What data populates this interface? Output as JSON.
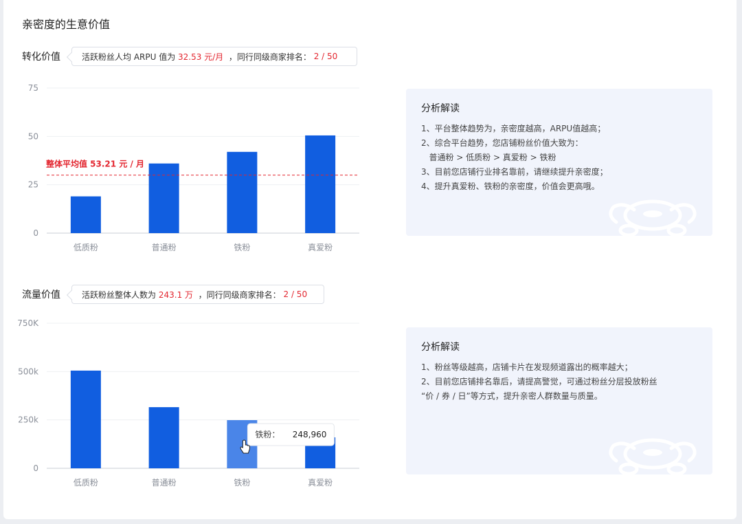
{
  "page_title": "亲密度的生意价值",
  "sections": [
    {
      "title": "转化价值",
      "callout": {
        "prefix": "活跃粉丝人均 ARPU 值为",
        "value": "32.53 元/月",
        "middle": "，同行同级商家排名：",
        "rank": "2 / 50"
      },
      "panel": {
        "title": "分析解读",
        "lines": [
          "1、平台整体趋势为，亲密度越高，ARPU值越高；",
          "2、综合平台趋势，您店铺粉丝价值大致为：",
          "   普通粉 > 低质粉 > 真爱粉 > 铁粉",
          "3、目前您店铺行业排名靠前，请继续提升亲密度；",
          "4、提升真爱粉、铁粉的亲密度，价值会更高哦。"
        ]
      }
    },
    {
      "title": "流量价值",
      "callout": {
        "prefix": "活跃粉丝整体人数为",
        "value": "243.1 万",
        "middle": "，同行同级商家排名：",
        "rank": "2 / 50"
      },
      "panel": {
        "title": "分析解读",
        "lines": [
          "1、粉丝等级越高，店铺卡片在发现频道露出的概率越大；",
          "2、目前您店铺排名靠后，请提高警觉，可通过粉丝分层投放粉丝",
          "“价 / 券 / 日”等方式，提升亲密人群数量与质量。"
        ]
      }
    }
  ],
  "chart_data": [
    {
      "type": "bar",
      "categories": [
        "低质粉",
        "普通粉",
        "铁粉",
        "真爱粉"
      ],
      "values": [
        19,
        36,
        42,
        50.5
      ],
      "ylim": [
        0,
        75
      ],
      "yticks": [
        0,
        25,
        50,
        75
      ],
      "ytick_labels": [
        "0",
        "25",
        "50",
        "75"
      ],
      "grid": true,
      "bar_color": "#115ee0",
      "reference_line": {
        "value": 30,
        "label": "整体平均值 53.21 元 / 月",
        "color": "#e3262f"
      }
    },
    {
      "type": "bar",
      "categories": [
        "低质粉",
        "普通粉",
        "铁粉",
        "真爱粉"
      ],
      "values": [
        505000,
        316000,
        248960,
        160000
      ],
      "ylim": [
        0,
        750000
      ],
      "yticks": [
        0,
        250000,
        500000,
        750000
      ],
      "ytick_labels": [
        "0",
        "250k",
        "500k",
        "750K"
      ],
      "grid": true,
      "bar_color": "#115ee0",
      "highlight_color": "#4a85e8",
      "tooltip": {
        "category_index": 2,
        "label": "铁粉：",
        "value": "248,960"
      }
    }
  ]
}
